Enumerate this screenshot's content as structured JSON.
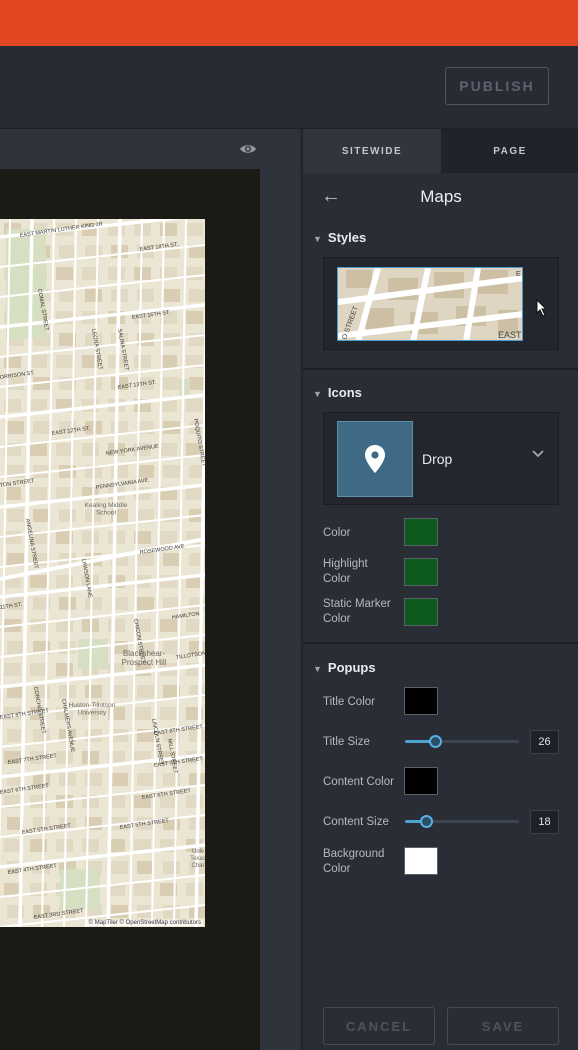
{
  "header": {
    "publish_label": "PUBLISH"
  },
  "canvas": {
    "eye_icon": "eye-icon",
    "map": {
      "attribution": "© MapTiler © OpenStreetMap contributors",
      "labels": [
        "EAST MARTIN LUTHER KING JR",
        "EAST 18TH ST.",
        "EAST 16TH ST.",
        "EAST 13TH ST.",
        "EAST 12TH ST.",
        "NEW YORK AVENUE",
        "PENNSYLVANIA AVE.",
        "ROSEWOOD AVE",
        "COMAL STREET",
        "LEONA STREET",
        "SALINA STREET",
        "ORRISON ST.",
        "TON STREET",
        "ANGELINA STREET",
        "LAWSON LANE",
        "CHICON STREET",
        "HAMILTON",
        "TILLOTSON AV",
        "POQUITO STREET",
        "CONCHO STREET",
        "CHALMERS AVENUE",
        "EAST 8TH STREET",
        "EAST 7TH STREET",
        "EAST 6TH STREET",
        "EAST 5TH STREET",
        "EAST 4TH STREET",
        "LINCOLN STREET",
        "MILL STREET",
        "EAST 6TH STREET",
        "EAST 7TH STREET",
        "EAST 8TH STREET",
        "EAST 5TH STREET",
        "11TH ST.",
        "EAST 3RD STREET"
      ],
      "places": {
        "school": [
          "Kealing Middle",
          "School"
        ],
        "hill": [
          "Blackshear-",
          "Prospect Hill"
        ],
        "university": [
          "Huston-Tillotson",
          "University"
        ],
        "texas": [
          "Univ",
          "Texas",
          "Char"
        ]
      }
    }
  },
  "panel": {
    "tabs": [
      {
        "label": "SITEWIDE"
      },
      {
        "label": "PAGE"
      }
    ],
    "title": "Maps",
    "back_icon": "arrow-left-icon",
    "styles": {
      "heading": "Styles",
      "thumb_labels": [
        "O STREET",
        "EAST",
        "E"
      ]
    },
    "icons": {
      "heading": "Icons",
      "selected_name": "Drop",
      "selected_icon": "map-pin-icon",
      "color_label": "Color",
      "color_value": "#0d5a1e",
      "highlight_label": [
        "Highlight",
        "Color"
      ],
      "highlight_value": "#0d5a1e",
      "static_label": [
        "Static Marker",
        "Color"
      ],
      "static_value": "#0d5a1e"
    },
    "popups": {
      "heading": "Popups",
      "title_color_label": "Title Color",
      "title_color_value": "#000000",
      "title_size_label": "Title Size",
      "title_size_value": "26",
      "title_size_fraction": 0.26,
      "content_color_label": "Content Color",
      "content_color_value": "#000000",
      "content_size_label": "Content Size",
      "content_size_value": "18",
      "content_size_fraction": 0.18,
      "background_label": [
        "Background",
        "Color"
      ],
      "background_value": "#ffffff"
    },
    "footer": {
      "cancel_label": "CANCEL",
      "save_label": "SAVE"
    }
  },
  "colors": {
    "accent": "#e34722",
    "slider": "#4fa3d4"
  }
}
